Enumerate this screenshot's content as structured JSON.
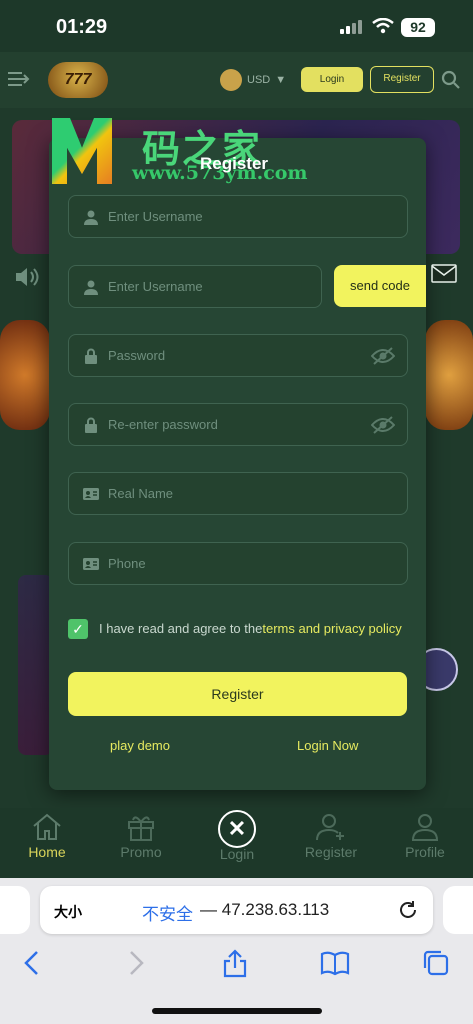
{
  "status_bar": {
    "time": "01:29",
    "battery": "92"
  },
  "header": {
    "logo_text": "777",
    "currency": "USD",
    "login_label": "Login",
    "register_label": "Register"
  },
  "watermark": {
    "chinese": "码之家",
    "url": "www.573ym.com"
  },
  "modal": {
    "title": "Register",
    "fields": [
      {
        "placeholder": "Enter Username",
        "icon": "user-icon"
      },
      {
        "placeholder": "Enter Username",
        "icon": "user-icon"
      },
      {
        "placeholder": "Password",
        "icon": "lock-icon"
      },
      {
        "placeholder": "Re-enter password",
        "icon": "lock-icon"
      },
      {
        "placeholder": "Real Name",
        "icon": "id-card-icon"
      },
      {
        "placeholder": "Phone",
        "icon": "id-card-icon"
      }
    ],
    "send_code_label": "send code",
    "agree_text": "I have read and agree to the",
    "agree_link": "terms and privacy policy",
    "register_button": "Register",
    "play_demo": "play demo",
    "login_now": "Login Now"
  },
  "bottom_nav": {
    "items": [
      {
        "label": "Home",
        "active": true
      },
      {
        "label": "Promo",
        "active": false
      },
      {
        "label": "Login",
        "active": false
      },
      {
        "label": "Register",
        "active": false
      },
      {
        "label": "Profile",
        "active": false
      }
    ]
  },
  "browser": {
    "text_size": "大小",
    "insecure": "不安全",
    "separator": "—",
    "url": "47.238.63.113"
  },
  "colors": {
    "accent": "#f2f35e",
    "modal_bg": "#264634",
    "page_bg": "#1f3a2b"
  }
}
